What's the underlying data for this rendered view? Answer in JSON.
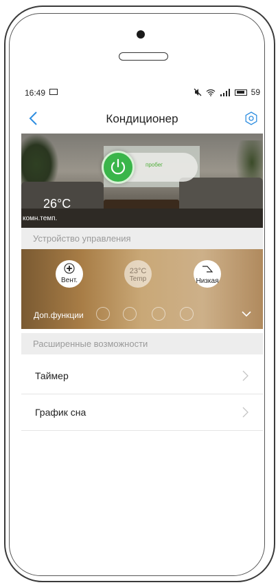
{
  "status_bar": {
    "time": "16:49",
    "battery": "59"
  },
  "header": {
    "title": "Кондиционер"
  },
  "hero": {
    "run_label": "пробег",
    "temperature": "26°C",
    "temperature_label": "комн.темп."
  },
  "control_section": {
    "heading": "Устройство управления"
  },
  "controls": {
    "fan_label": "Вент.",
    "temp_value": "23°C",
    "temp_label": "Temp",
    "speed_label": "Низкая",
    "extra_label": "Доп.функции"
  },
  "advanced_section": {
    "heading": "Расширенные возможности"
  },
  "menu": [
    {
      "label": "Таймер"
    },
    {
      "label": "График сна"
    }
  ],
  "colors": {
    "accent": "#2d8de0",
    "power": "#3ab54a"
  }
}
